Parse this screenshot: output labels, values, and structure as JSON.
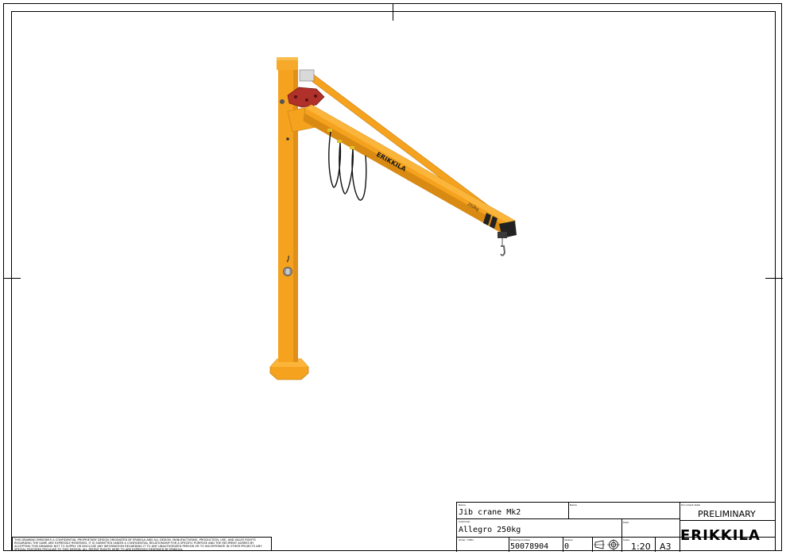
{
  "title_block": {
    "name_label": "Name",
    "name_value": "Jib crane Mk2",
    "name2_label": "Name",
    "customer_label": "Customer",
    "customer_value": "Allegro 250kg",
    "order_label": "Order / Offer",
    "drawing_number_label": "Drawing number",
    "drawing_number_value": "50078904",
    "version_label": "Version",
    "version_value": "0",
    "date_label": "Date",
    "scale_label": "Scale",
    "scale_value": "1:20",
    "sheet_size_value": "A3",
    "document_state_label": "Document state",
    "document_state_value": "PRELIMINARY",
    "company_logo": "ERIKKILA"
  },
  "crane": {
    "boom_brand": "ERIKKILA",
    "capacity_marking": "250kg"
  },
  "disclaimer": "THIS DRAWING EMBODIES A CONFIDENTIAL PROPRIETARY DESIGN ORIGINATED BY ERIKKILA AND ALL DESIGN, MANUFACTURING, PRODUCTION, USE, AND SALES RIGHTS REGARDING THE SAME ARE EXPRESSLY RESERVED. IT IS SUBMITTED UNDER A CONFIDENTIAL RELATIONSHIP FOR A SPECIFIC PURPOSE AND THE RECIPIENT AGREES BY ACCEPTING THIS DRAWING NOT TO SUPPLY OR DISCLOSE ANY INFORMATION REGARDING IT TO ANY UNAUTHORIZED PERSON OR TO INCORPORATE IN OTHER PROJECTS ANY SPECIAL FEATURES PECULIAR TO THIS DESIGN. ALL PATENT RIGHTS HERE TO ARE EXPRESSLY RESERVED BY ERIKKILA.",
  "colors": {
    "crane_orange": "#F5A21E",
    "crane_shadow": "#D98A12",
    "slewing_red": "#B0302A",
    "frame_black": "#000000"
  },
  "icons": [
    "third-angle-projection-icon",
    "hook-icon"
  ]
}
